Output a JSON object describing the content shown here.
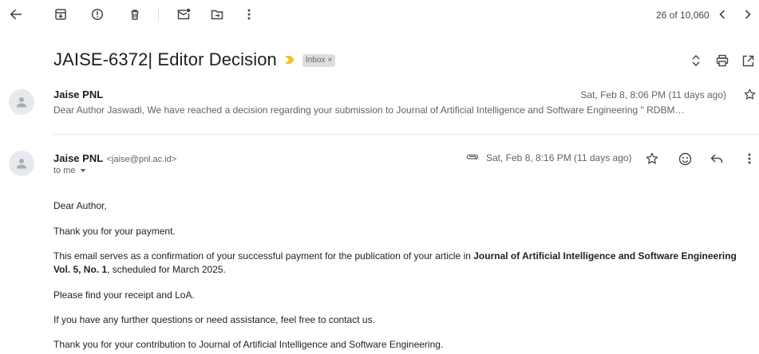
{
  "toolbar": {
    "counter": "26 of 10,060"
  },
  "subject": {
    "title": "JAISE-6372| Editor Decision",
    "label": "Inbox",
    "label_close": "×"
  },
  "collapsed_message": {
    "sender": "Jaise PNL",
    "date": "Sat, Feb 8, 8:06 PM (11 days ago)",
    "snippet": "Dear Author Jaswadi, We have reached a decision regarding your submission to Journal of Artificial Intelligence and Software Engineering \" RDBM…"
  },
  "message": {
    "sender": "Jaise PNL",
    "email": "<jaise@pnl.ac.id>",
    "to": "to me",
    "date": "Sat, Feb 8, 8:16 PM (11 days ago)",
    "body": {
      "greeting": "Dear Author,",
      "p1": "Thank you for your payment.",
      "p2_pre": "This email serves as a confirmation of your successful payment for the publication of your article in ",
      "p2_bold": "Journal of Artificial Intelligence and Software Engineering Vol. 5, No. 1",
      "p2_post": ", scheduled for March 2025.",
      "p3": "Please find your receipt and LoA.",
      "p4": "If you have any further questions or need assistance, feel free to contact us.",
      "p5": "Thank you for your contribution to Journal of Artificial Intelligence and Software Engineering."
    }
  },
  "icons": {
    "back": "arrow-left",
    "archive": "archive",
    "spam": "report-spam",
    "delete": "trash",
    "unread": "mark-unread",
    "move": "move-to",
    "more": "more-vert",
    "older": "chevron-left",
    "newer": "chevron-right",
    "expand": "unfold",
    "print": "print",
    "new_window": "open-in-new",
    "important": "important-marker",
    "attachment": "attachment",
    "star": "star",
    "emoji": "emoji",
    "reply": "reply",
    "dropdown": "caret-down",
    "avatar": "person"
  },
  "colors": {
    "important_marker": "#f6c026",
    "label_bg": "#dddddd",
    "avatar_bg": "#e6e9ed"
  }
}
